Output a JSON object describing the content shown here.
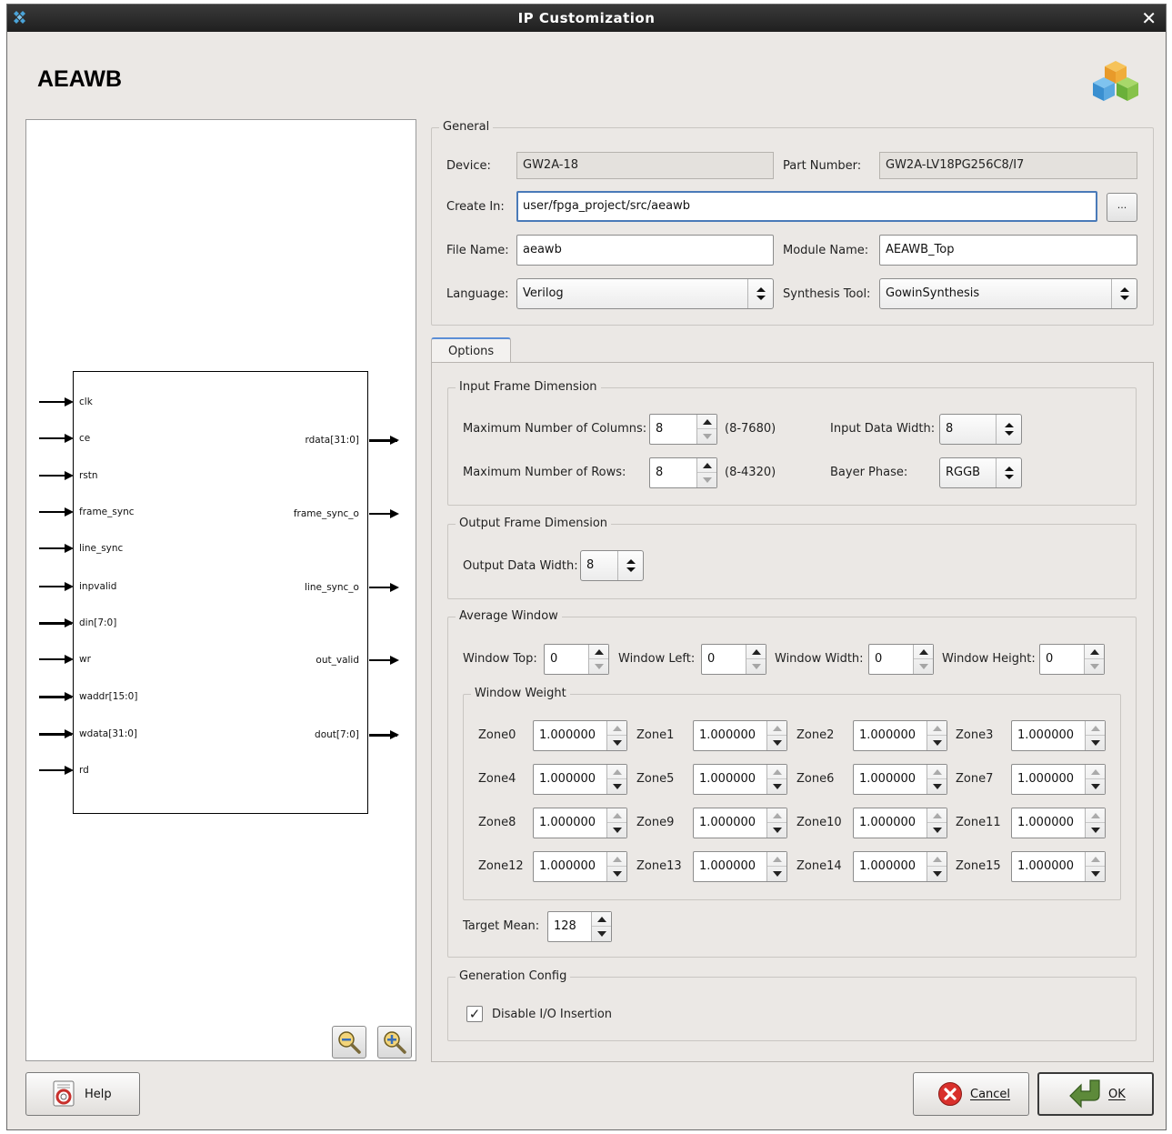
{
  "window": {
    "title": "IP Customization",
    "close_glyph": "✕"
  },
  "header": {
    "title": "AEAWB",
    "icon": "ip-cubes-icon"
  },
  "symbol": {
    "inputs": [
      "clk",
      "ce",
      "rstn",
      "frame_sync",
      "line_sync",
      "inpvalid",
      "din[7:0]",
      "wr",
      "waddr[15:0]",
      "wdata[31:0]",
      "rd"
    ],
    "outputs": [
      "rdata[31:0]",
      "frame_sync_o",
      "line_sync_o",
      "out_valid",
      "dout[7:0]"
    ]
  },
  "general": {
    "title": "General",
    "device_label": "Device:",
    "device_value": "GW2A-18",
    "part_number_label": "Part Number:",
    "part_number_value": "GW2A-LV18PG256C8/I7",
    "create_in_label": "Create In:",
    "create_in_value": "user/fpga_project/src/aeawb",
    "browse_label": "...",
    "file_name_label": "File Name:",
    "file_name_value": "aeawb",
    "module_name_label": "Module Name:",
    "module_name_value": "AEAWB_Top",
    "language_label": "Language:",
    "language_value": "Verilog",
    "synthesis_tool_label": "Synthesis Tool:",
    "synthesis_tool_value": "GowinSynthesis"
  },
  "options_tab": {
    "label": "Options"
  },
  "input_frame": {
    "title": "Input Frame Dimension",
    "max_cols_label": "Maximum Number of Columns:",
    "max_cols_value": "8",
    "max_cols_range": "(8-7680)",
    "max_rows_label": "Maximum Number of Rows:",
    "max_rows_value": "8",
    "max_rows_range": "(8-4320)",
    "input_width_label": "Input Data Width:",
    "input_width_value": "8",
    "bayer_label": "Bayer Phase:",
    "bayer_value": "RGGB"
  },
  "output_frame": {
    "title": "Output Frame Dimension",
    "output_width_label": "Output Data Width:",
    "output_width_value": "8"
  },
  "average_window": {
    "title": "Average Window",
    "top_label": "Window Top:",
    "top_value": "0",
    "left_label": "Window Left:",
    "left_value": "0",
    "width_label": "Window Width:",
    "width_value": "0",
    "height_label": "Window Height:",
    "height_value": "0",
    "weight_title": "Window Weight",
    "zones": [
      {
        "label": "Zone0",
        "value": "1.000000"
      },
      {
        "label": "Zone1",
        "value": "1.000000"
      },
      {
        "label": "Zone2",
        "value": "1.000000"
      },
      {
        "label": "Zone3",
        "value": "1.000000"
      },
      {
        "label": "Zone4",
        "value": "1.000000"
      },
      {
        "label": "Zone5",
        "value": "1.000000"
      },
      {
        "label": "Zone6",
        "value": "1.000000"
      },
      {
        "label": "Zone7",
        "value": "1.000000"
      },
      {
        "label": "Zone8",
        "value": "1.000000"
      },
      {
        "label": "Zone9",
        "value": "1.000000"
      },
      {
        "label": "Zone10",
        "value": "1.000000"
      },
      {
        "label": "Zone11",
        "value": "1.000000"
      },
      {
        "label": "Zone12",
        "value": "1.000000"
      },
      {
        "label": "Zone13",
        "value": "1.000000"
      },
      {
        "label": "Zone14",
        "value": "1.000000"
      },
      {
        "label": "Zone15",
        "value": "1.000000"
      }
    ],
    "target_mean_label": "Target Mean:",
    "target_mean_value": "128"
  },
  "generation": {
    "title": "Generation Config",
    "disable_io_label": "Disable I/O Insertion",
    "disable_io_checked": true
  },
  "buttons": {
    "help": "Help",
    "cancel": "Cancel",
    "ok": "OK"
  },
  "colors": {
    "accent": "#5b8ed6",
    "cancel_red": "#d9302c",
    "ok_green": "#5d8a3a"
  }
}
